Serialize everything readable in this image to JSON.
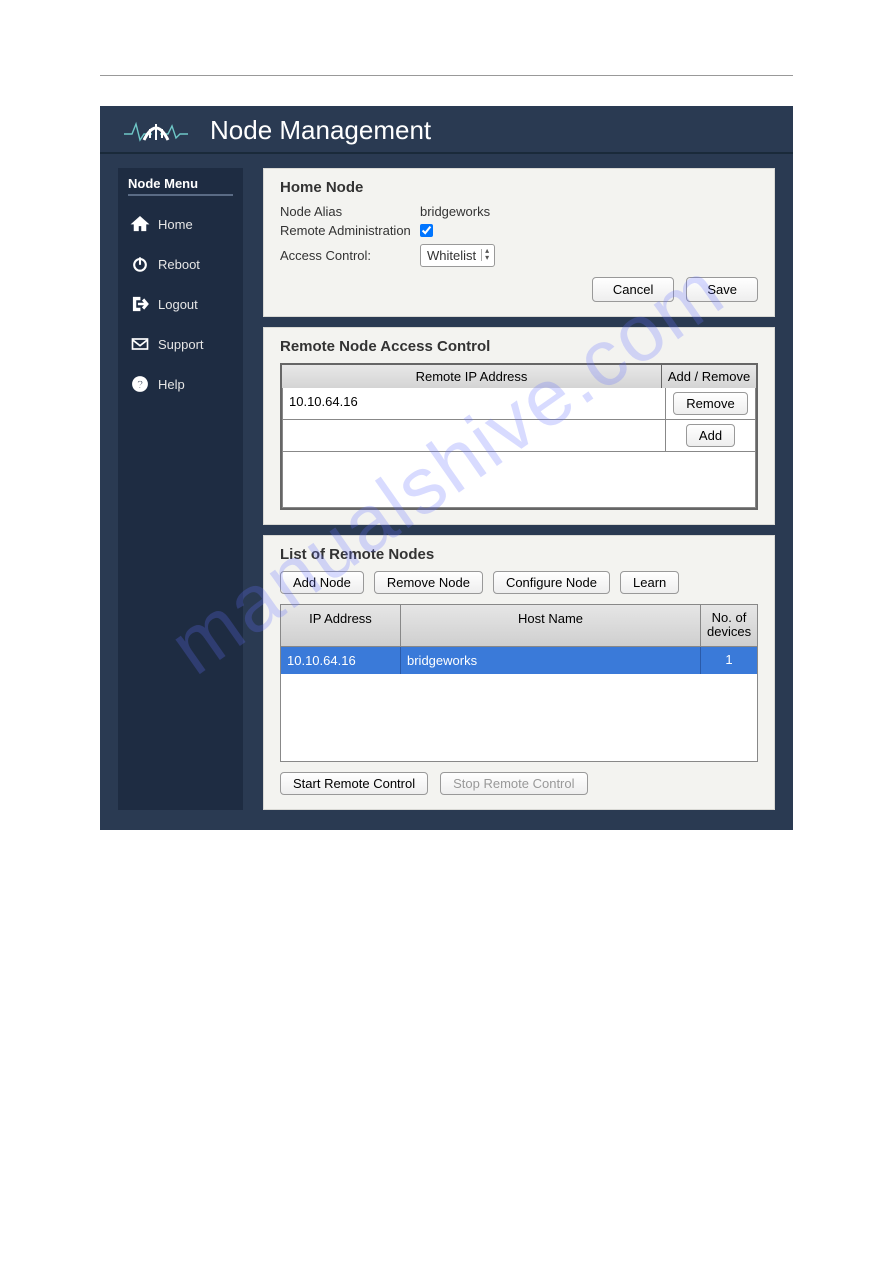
{
  "header": {
    "title": "Node Management"
  },
  "sidebar": {
    "title": "Node Menu",
    "items": [
      {
        "label": "Home"
      },
      {
        "label": "Reboot"
      },
      {
        "label": "Logout"
      },
      {
        "label": "Support"
      },
      {
        "label": "Help"
      }
    ]
  },
  "homeNode": {
    "title": "Home Node",
    "aliasLabel": "Node Alias",
    "aliasValue": "bridgeworks",
    "remoteAdminLabel": "Remote Administration",
    "remoteAdminChecked": true,
    "accessControlLabel": "Access Control:",
    "accessControlValue": "Whitelist",
    "cancel": "Cancel",
    "save": "Save"
  },
  "accessControl": {
    "title": "Remote Node Access Control",
    "colIp": "Remote IP Address",
    "colAction": "Add / Remove",
    "rows": [
      {
        "ip": "10.10.64.16",
        "action": "Remove"
      }
    ],
    "newIp": "",
    "addLabel": "Add"
  },
  "remoteNodes": {
    "title": "List of Remote Nodes",
    "buttons": {
      "addNode": "Add Node",
      "removeNode": "Remove Node",
      "configureNode": "Configure Node",
      "learn": "Learn"
    },
    "cols": {
      "ip": "IP Address",
      "host": "Host Name",
      "devices": "No. of devices"
    },
    "rows": [
      {
        "ip": "10.10.64.16",
        "host": "bridgeworks",
        "devices": "1"
      }
    ],
    "startRemote": "Start Remote Control",
    "stopRemote": "Stop Remote Control"
  },
  "watermark": "manualshive.com"
}
